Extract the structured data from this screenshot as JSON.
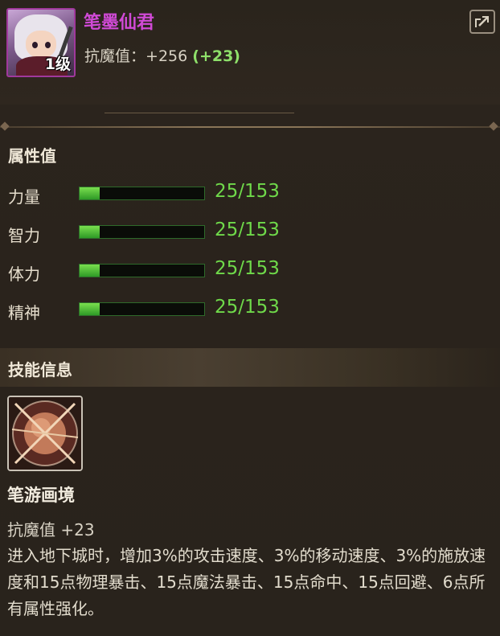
{
  "item": {
    "name": "笔墨仙君",
    "level_badge": "1级",
    "resist_label": "抗魔值",
    "resist_value": "+256",
    "resist_bonus": "(+23)"
  },
  "icons": {
    "share": "share-icon",
    "skill": "brush-orb-icon"
  },
  "attributes": {
    "title": "属性值",
    "rows": [
      {
        "label": "力量",
        "value": "25/153",
        "ratio": 0.163
      },
      {
        "label": "智力",
        "value": "25/153",
        "ratio": 0.163
      },
      {
        "label": "体力",
        "value": "25/153",
        "ratio": 0.163
      },
      {
        "label": "精神",
        "value": "25/153",
        "ratio": 0.163
      }
    ]
  },
  "skill": {
    "section_title": "技能信息",
    "name": "笔游画境",
    "resist": "抗魔值 +23",
    "description": "进入地下城时，增加3%的攻击速度、3%的移动速度、3%的施放速度和15点物理暴击、15点魔法暴击、15点命中、15点回避、6点所有属性强化。"
  },
  "colors": {
    "name": "#d04ad6",
    "bonus": "#8ee06a",
    "stat_value": "#6fd94a"
  }
}
